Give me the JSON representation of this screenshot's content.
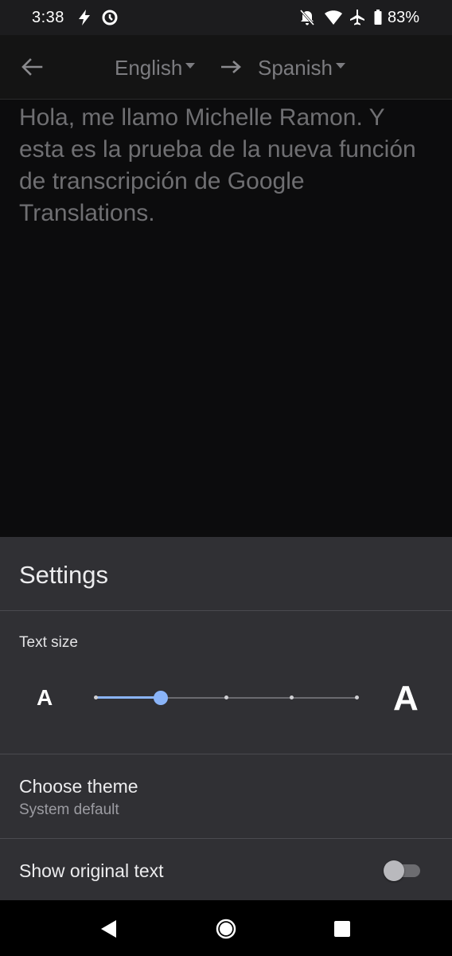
{
  "status_bar": {
    "time": "3:38",
    "battery": "83%",
    "icons": [
      "flash-icon",
      "data-saver-icon",
      "notifications-off-icon",
      "wifi-icon",
      "airplane-icon",
      "battery-icon"
    ]
  },
  "app_bar": {
    "source_language": "English",
    "target_language": "Spanish"
  },
  "transcript": {
    "text": "Hola, me llamo Michelle Ramon. Y esta es la prueba de la nueva función de transcripción de Google Translations."
  },
  "settings": {
    "title": "Settings",
    "text_size": {
      "label": "Text size",
      "small_glyph": "A",
      "large_glyph": "A",
      "steps": 5,
      "selected_step": 2
    },
    "theme": {
      "title": "Choose theme",
      "value": "System default"
    },
    "show_original": {
      "label": "Show original text",
      "enabled": false
    }
  },
  "colors": {
    "accent": "#8ab4f8",
    "sheet_background": "#303034",
    "screen_background": "#0c0c0d"
  }
}
